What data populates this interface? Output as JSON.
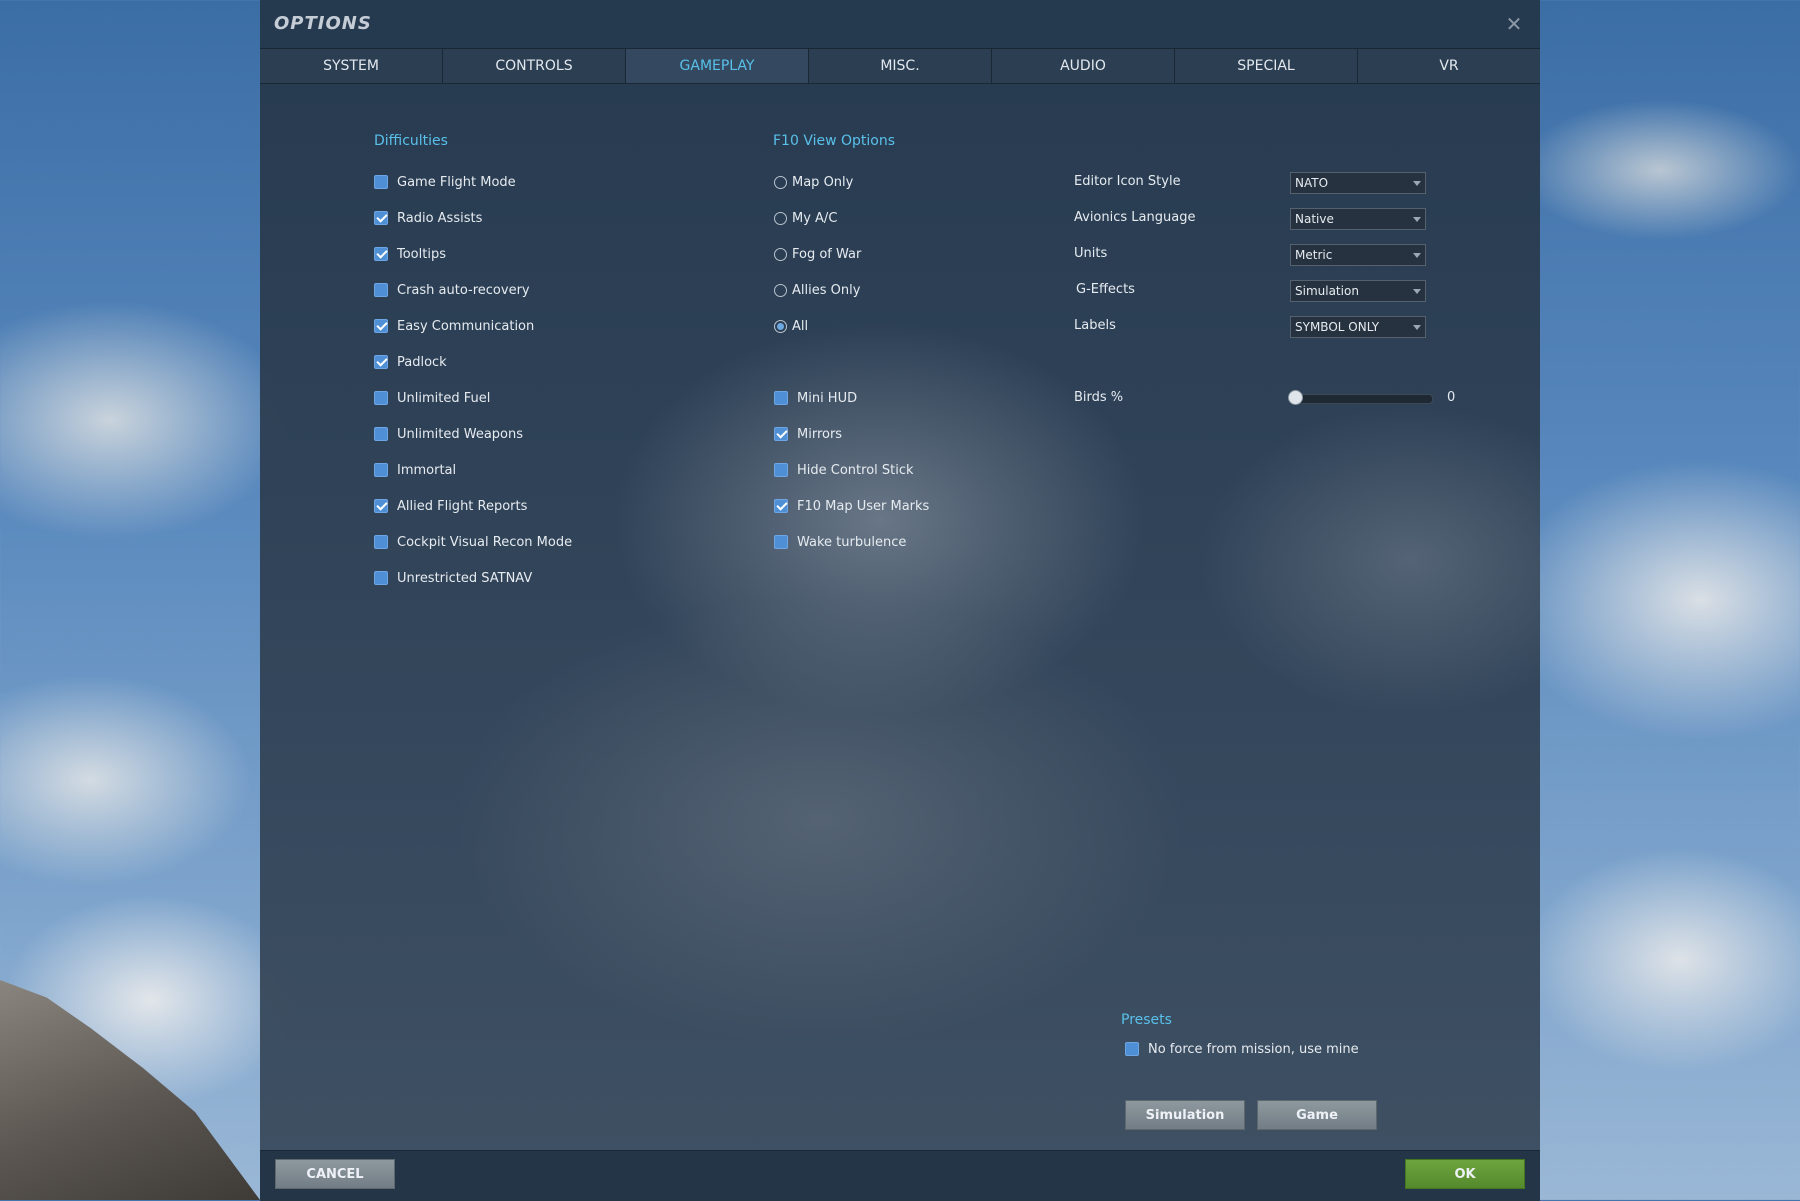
{
  "window": {
    "title": "OPTIONS",
    "close_glyph": "✕"
  },
  "tabs": [
    {
      "label": "SYSTEM"
    },
    {
      "label": "CONTROLS"
    },
    {
      "label": "GAMEPLAY",
      "active": true
    },
    {
      "label": "MISC."
    },
    {
      "label": "AUDIO"
    },
    {
      "label": "SPECIAL"
    },
    {
      "label": "VR"
    }
  ],
  "difficulties": {
    "title": "Difficulties",
    "items": [
      {
        "label": "Game Flight Mode",
        "checked": false
      },
      {
        "label": "Radio Assists",
        "checked": true
      },
      {
        "label": "Tooltips",
        "checked": true
      },
      {
        "label": "Crash auto-recovery",
        "checked": false
      },
      {
        "label": "Easy Communication",
        "checked": true
      },
      {
        "label": "Padlock",
        "checked": true
      },
      {
        "label": "Unlimited Fuel",
        "checked": false
      },
      {
        "label": "Unlimited Weapons",
        "checked": false
      },
      {
        "label": "Immortal",
        "checked": false
      },
      {
        "label": "Allied Flight Reports",
        "checked": true
      },
      {
        "label": "Cockpit Visual Recon Mode",
        "checked": false
      },
      {
        "label": "Unrestricted SATNAV",
        "checked": false
      }
    ]
  },
  "f10": {
    "title": "F10 View Options",
    "radios": [
      {
        "label": "Map Only",
        "checked": false
      },
      {
        "label": "My A/C",
        "checked": false
      },
      {
        "label": "Fog of War",
        "checked": false
      },
      {
        "label": "Allies Only",
        "checked": false
      },
      {
        "label": "All",
        "checked": true
      }
    ],
    "checkboxes": [
      {
        "label": "Mini HUD",
        "checked": false
      },
      {
        "label": "Mirrors",
        "checked": true
      },
      {
        "label": "Hide Control Stick",
        "checked": false
      },
      {
        "label": "F10 Map User Marks",
        "checked": true
      },
      {
        "label": "Wake turbulence",
        "checked": false
      }
    ]
  },
  "settings": [
    {
      "label": "Editor Icon Style",
      "value": "NATO"
    },
    {
      "label": "Avionics Language",
      "value": "Native"
    },
    {
      "label": "Units",
      "value": "Metric"
    },
    {
      "label": "G-Effects",
      "value": "Simulation"
    },
    {
      "label": "Labels",
      "value": "SYMBOL ONLY"
    }
  ],
  "birds": {
    "label": "Birds %",
    "value": "0",
    "fraction": 0
  },
  "presets": {
    "title": "Presets",
    "no_force": {
      "label": "No force from mission, use mine",
      "checked": false
    },
    "simulation_label": "Simulation",
    "game_label": "Game"
  },
  "footer": {
    "cancel_label": "CANCEL",
    "ok_label": "OK"
  },
  "colors": {
    "accent": "#59c0ea",
    "checkbox": "#4f8fd6",
    "ok_green": "#5e9934"
  }
}
